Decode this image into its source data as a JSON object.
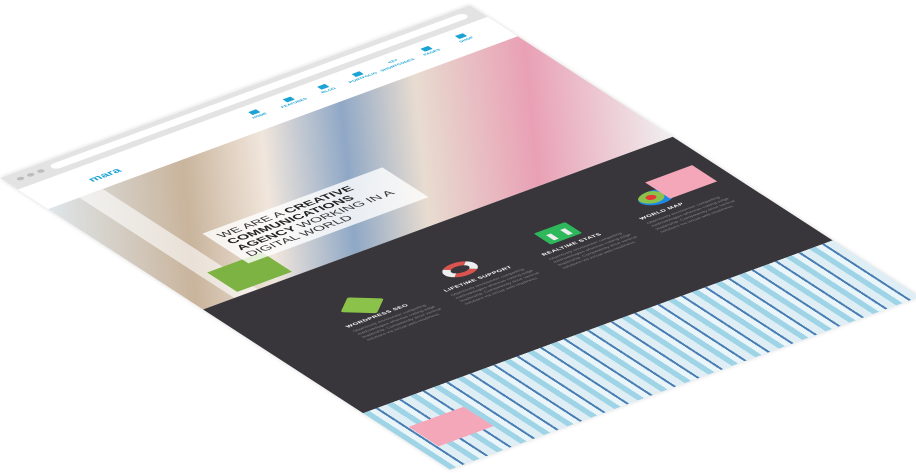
{
  "header": {
    "logo": "mara"
  },
  "nav": [
    {
      "label": "HOME",
      "icon": "home-icon"
    },
    {
      "label": "FEATURES",
      "icon": "thumbs-up-icon"
    },
    {
      "label": "BLOG",
      "icon": "blog-icon"
    },
    {
      "label": "PORTFOLIO",
      "icon": "portfolio-icon"
    },
    {
      "label": "SHORTCODES",
      "icon": "code-icon"
    },
    {
      "label": "PAGES",
      "icon": "pages-icon"
    },
    {
      "label": "SHOP",
      "icon": "cart-icon"
    }
  ],
  "hero": {
    "line1a": "We are a ",
    "line1b": "creative",
    "line2": "communications",
    "line3a": "agency",
    "line3b": " working in a",
    "line4": "digital world"
  },
  "features": [
    {
      "title": "WORDPRESS SEO",
      "text": "Objectively envisioneer compelling methodologies whereas cutting-edge leadership. Competently drive vertical solutions via virtual web-readiness.",
      "icon": "checkmark-icon"
    },
    {
      "title": "LIFETIME SUPPORT",
      "text": "Objectively envisioneer compelling methodologies whereas cutting-edge leadership. Competently drive vertical solutions via virtual web-readiness.",
      "icon": "lifebuoy-icon"
    },
    {
      "title": "REALTIME STATS",
      "text": "Objectively envisioneer compelling methodologies whereas cutting-edge leadership. Competently drive vertical solutions via virtual web-readiness.",
      "icon": "bar-chart-icon"
    },
    {
      "title": "WORLD MAP",
      "text": "Objectively envisioneer compelling methodologies whereas cutting-edge leadership. Competently drive vertical solutions via virtual web-readiness.",
      "icon": "globe-map-icon"
    }
  ],
  "colors": {
    "accent": "#1aa3d4",
    "dark_band": "#38363a"
  }
}
